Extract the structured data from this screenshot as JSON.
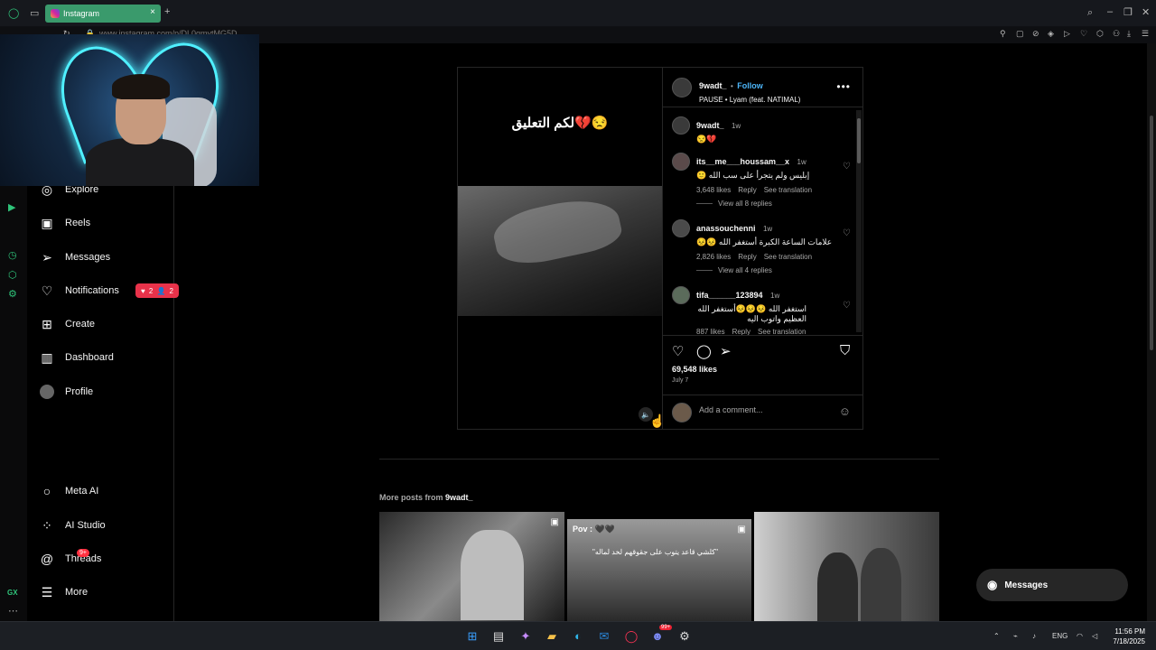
{
  "browser": {
    "tab_title": "Instagram",
    "tab_close": "×",
    "new_tab": "+",
    "url": "www.instagram.com/p/DL0qmytMG5D",
    "sidebar_label": "GX"
  },
  "nav": {
    "items": [
      {
        "label": "Explore",
        "icon": "compass-icon"
      },
      {
        "label": "Reels",
        "icon": "reels-icon"
      },
      {
        "label": "Messages",
        "icon": "send-icon"
      },
      {
        "label": "Notifications",
        "icon": "heart-icon"
      },
      {
        "label": "Create",
        "icon": "plus-square-icon"
      },
      {
        "label": "Dashboard",
        "icon": "chart-icon"
      },
      {
        "label": "Profile",
        "icon": "avatar-icon"
      },
      {
        "label": "Meta AI",
        "icon": "meta-ai-icon"
      },
      {
        "label": "AI Studio",
        "icon": "ai-studio-icon"
      },
      {
        "label": "Threads",
        "icon": "threads-icon"
      },
      {
        "label": "More",
        "icon": "menu-icon"
      }
    ],
    "notif_likes": "2",
    "notif_follows": "2",
    "threads_badge": "9+"
  },
  "post": {
    "media_caption": "لكم التعليق💔😒",
    "author": "9wadt_",
    "separator": "•",
    "follow": "Follow",
    "audio": "PAUSE • Lyam (feat. NATIMAL)",
    "caption_author": "9wadt_",
    "caption_time": "1w",
    "caption_text": "😒💔",
    "comments": [
      {
        "user": "its__me___houssam__x",
        "time": "1w",
        "text": "إبليس ولم يتجرأ على سب الله 🙂",
        "likes": "3,648 likes",
        "reply": "Reply",
        "translate": "See translation",
        "view_replies": "View all 8 replies"
      },
      {
        "user": "anassouchenni",
        "time": "1w",
        "text": "علامات الساعة الكبرة أستغفر الله 😣😣",
        "likes": "2,826 likes",
        "reply": "Reply",
        "translate": "See translation",
        "view_replies": "View all 4 replies"
      },
      {
        "user": "tifa______123894",
        "time": "1w",
        "text": "استغفر الله 😣😣😣أستغفر الله العظيم واتوب اليه",
        "likes": "887 likes",
        "reply": "Reply",
        "translate": "See translation"
      }
    ],
    "likes": "69,548 likes",
    "date": "July 7",
    "comment_placeholder": "Add a comment..."
  },
  "more_posts": {
    "label_prefix": "More posts from",
    "author": "9wadt_",
    "thumb2_text_top": "Pov : 🖤🖤",
    "thumb2_text": "\"كلشي قاعد يتوب على جقوقهم لخد لماله\""
  },
  "messages_pill": "Messages",
  "taskbar": {
    "language": "ENG",
    "time": "11:56 PM",
    "date": "7/18/2025",
    "badge": "99+"
  },
  "colors": {
    "accent_blue": "#4cb5f9",
    "notif_red": "#e8324a",
    "opera_green": "#2fc47a",
    "tab_green": "#3a9a6c"
  }
}
